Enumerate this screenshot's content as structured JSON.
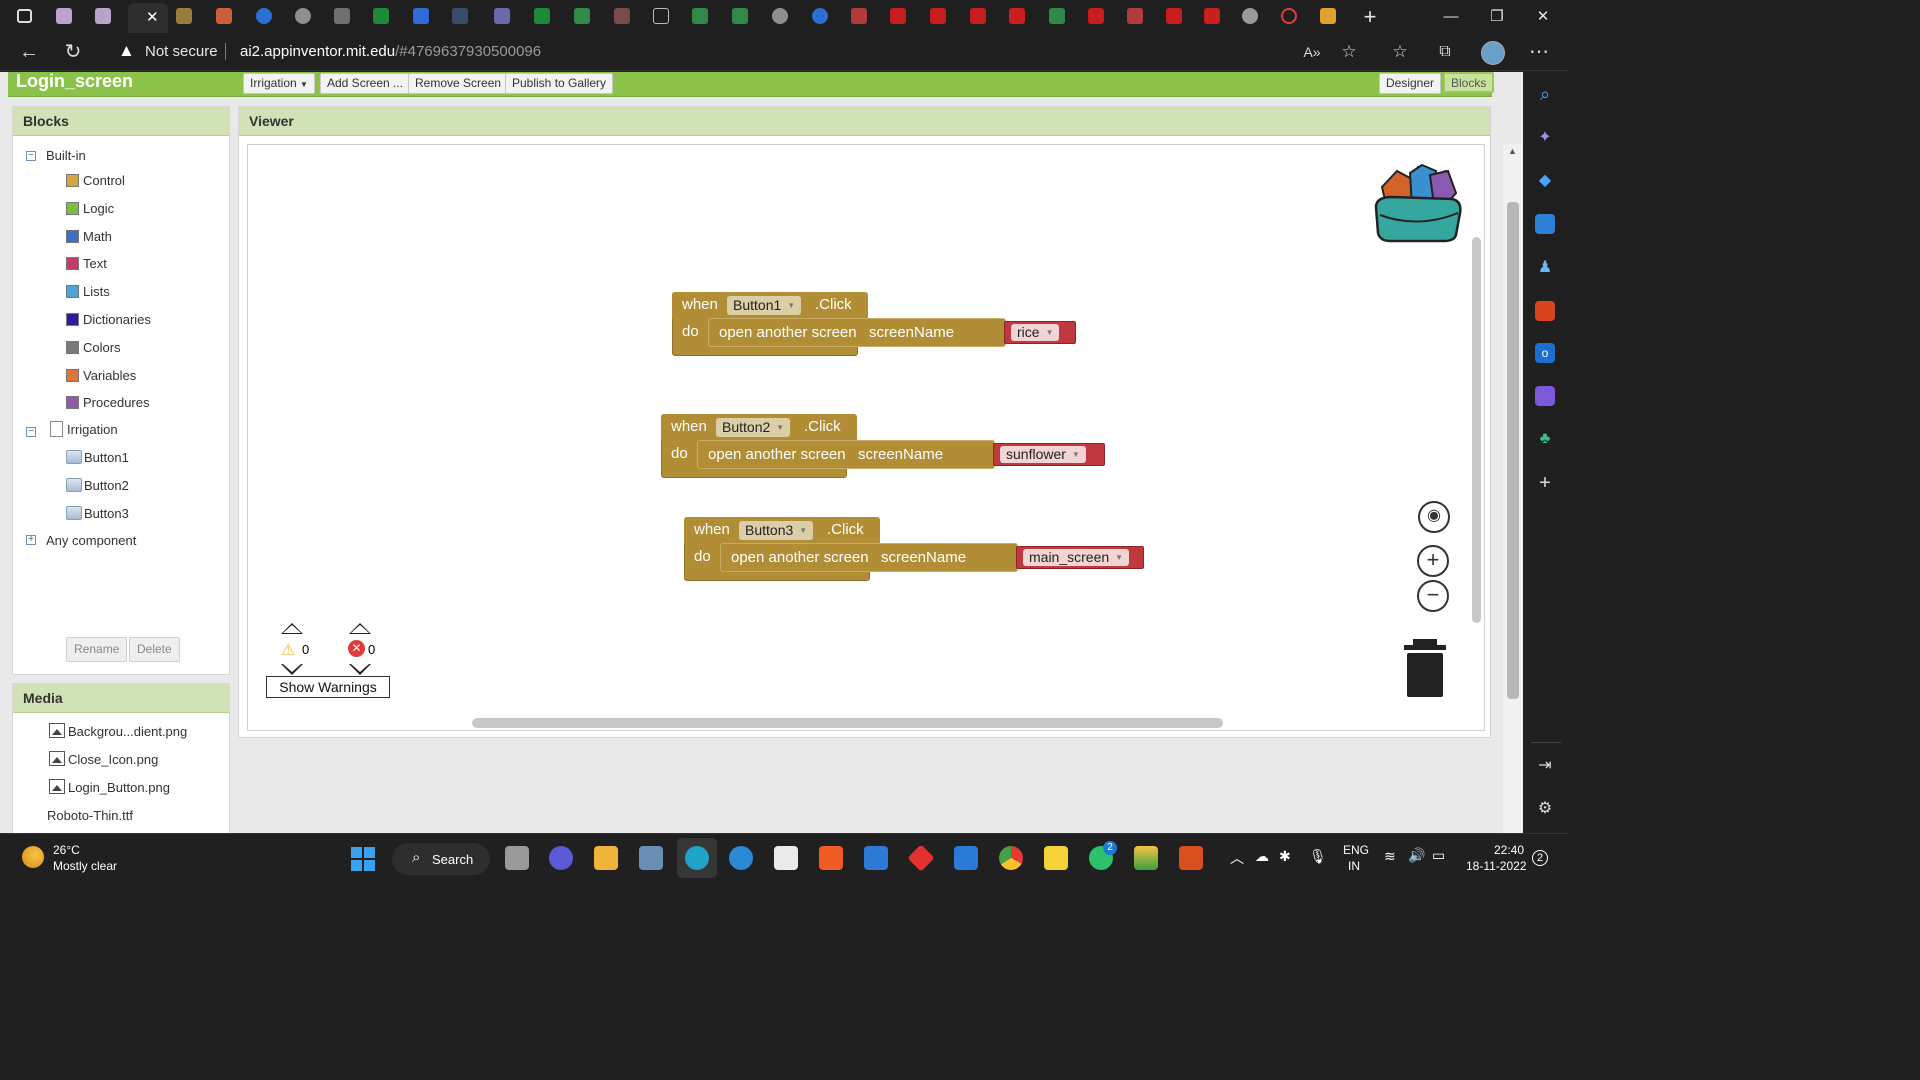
{
  "browser": {
    "security_label": "Not secure",
    "url_host": "ai2.appinventor.mit.edu",
    "url_path": "/#4769637930500096"
  },
  "appbar": {
    "screen_title": "Login_screen",
    "screen_dropdown": "Irrigation",
    "add_screen": "Add Screen ...",
    "remove_screen": "Remove Screen",
    "publish": "Publish to Gallery",
    "designer": "Designer",
    "blocks": "Blocks"
  },
  "blocks_panel": {
    "title": "Blocks",
    "builtin_label": "Built-in",
    "builtins": [
      {
        "label": "Control",
        "color": "#d2a83e"
      },
      {
        "label": "Logic",
        "color": "#7bbf3f"
      },
      {
        "label": "Math",
        "color": "#3f6fc1"
      },
      {
        "label": "Text",
        "color": "#c23b6b"
      },
      {
        "label": "Lists",
        "color": "#4aa6d6"
      },
      {
        "label": "Dictionaries",
        "color": "#2d1b9e"
      },
      {
        "label": "Colors",
        "color": "#7a7a7a"
      },
      {
        "label": "Variables",
        "color": "#e2743a"
      },
      {
        "label": "Procedures",
        "color": "#8f5ba8"
      }
    ],
    "screen_label": "Irrigation",
    "components": [
      "Button1",
      "Button2",
      "Button3"
    ],
    "any_component": "Any component",
    "rename": "Rename",
    "delete": "Delete"
  },
  "media_panel": {
    "title": "Media",
    "files": [
      "Backgrou...dient.png",
      "Close_Icon.png",
      "Login_Button.png"
    ],
    "font_file": "Roboto-Thin.ttf"
  },
  "viewer": {
    "title": "Viewer",
    "blocks": [
      {
        "when": "when",
        "component": "Button1",
        "event": ".Click",
        "do": "do",
        "action": "open another screen",
        "param": "screenName",
        "value": "rice"
      },
      {
        "when": "when",
        "component": "Button2",
        "event": ".Click",
        "do": "do",
        "action": "open another screen",
        "param": "screenName",
        "value": "sunflower"
      },
      {
        "when": "when",
        "component": "Button3",
        "event": ".Click",
        "do": "do",
        "action": "open another screen",
        "param": "screenName",
        "value": "main_screen"
      }
    ],
    "warnings_count": "0",
    "errors_count": "0",
    "show_warnings": "Show Warnings"
  },
  "taskbar": {
    "temp": "26°C",
    "weather": "Mostly clear",
    "search": "Search",
    "lang1": "ENG",
    "lang2": "IN",
    "time": "22:40",
    "date": "18-11-2022",
    "notif_count": "2",
    "whatsapp_badge": "2"
  }
}
